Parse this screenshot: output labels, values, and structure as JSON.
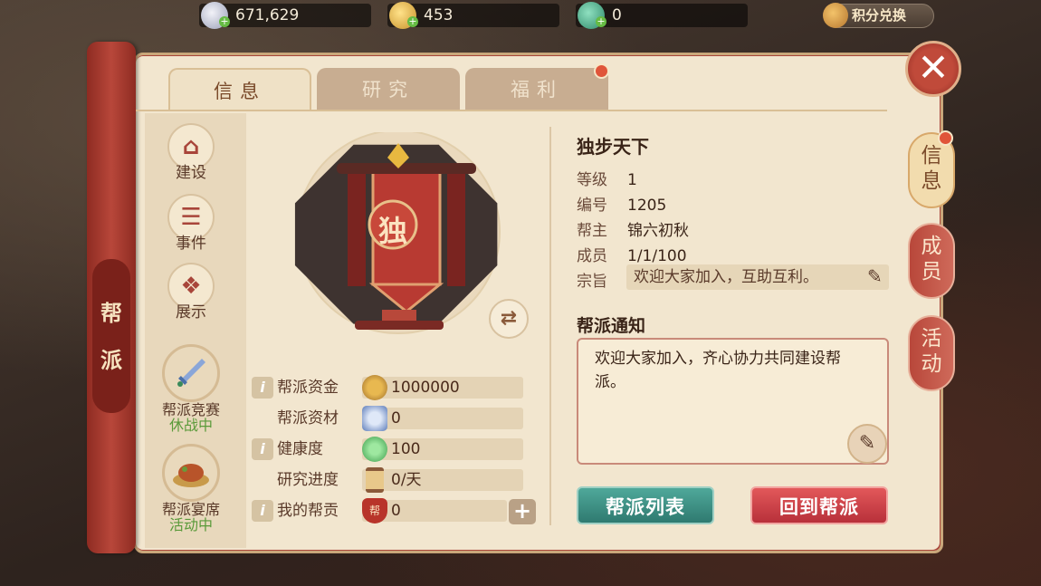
{
  "resources": [
    {
      "icon": "silver-coin-icon",
      "value": "671,629"
    },
    {
      "icon": "gold-coin-icon",
      "value": "453"
    },
    {
      "icon": "jade-icon",
      "value": "0"
    }
  ],
  "shop": {
    "label": "积分兑换",
    "icon": "money-bag-icon"
  },
  "side_scroll": {
    "chars": [
      "帮",
      "派"
    ]
  },
  "tabs": [
    {
      "label": "信息",
      "active": true
    },
    {
      "label": "研究",
      "active": false
    },
    {
      "label": "福利",
      "active": false,
      "badge": true
    }
  ],
  "left_menu": [
    {
      "label": "建设",
      "icon": "pagoda-icon"
    },
    {
      "label": "事件",
      "icon": "scroll-list-icon"
    },
    {
      "label": "展示",
      "icon": "book-icon"
    }
  ],
  "left_bottom": [
    {
      "label": "帮派竞赛",
      "status": "休战中",
      "icon": "sword-icon"
    },
    {
      "label": "帮派宴席",
      "status": "活动中",
      "icon": "feast-icon"
    }
  ],
  "emblem": {
    "char": "独"
  },
  "stats": [
    {
      "label": "帮派资金",
      "info": true,
      "icon": "coin-icon",
      "value": "1000000"
    },
    {
      "label": "帮派资材",
      "info": false,
      "icon": "material-icon",
      "value": "0"
    },
    {
      "label": "健康度",
      "info": true,
      "icon": "heart-plus-icon",
      "value": "100"
    },
    {
      "label": "研究进度",
      "info": false,
      "icon": "hourglass-icon",
      "value": "0/天"
    },
    {
      "label": "我的帮贡",
      "info": true,
      "icon": "contribution-badge-icon",
      "value": "0",
      "badge_char": "帮"
    }
  ],
  "guild": {
    "name": "独步天下",
    "rows": [
      {
        "k": "等级",
        "v": "1"
      },
      {
        "k": "编号",
        "v": "1205"
      },
      {
        "k": "帮主",
        "v": "锦六初秋"
      },
      {
        "k": "成员",
        "v": "1/1/100"
      }
    ],
    "motto_label": "宗旨",
    "motto": "欢迎大家加入，互助互利。"
  },
  "notice": {
    "title": "帮派通知",
    "text": "欢迎大家加入，齐心协力共同建设帮派。"
  },
  "buttons": {
    "list": "帮派列表",
    "back": "回到帮派"
  },
  "vtabs": [
    {
      "label": "信息",
      "active": true,
      "badge": true
    },
    {
      "label": "成员",
      "active": false
    },
    {
      "label": "活动",
      "active": false
    }
  ],
  "colors": {
    "accent_red": "#b8303a",
    "accent_green": "#2f7a70",
    "panel": "#f2e6cf"
  }
}
